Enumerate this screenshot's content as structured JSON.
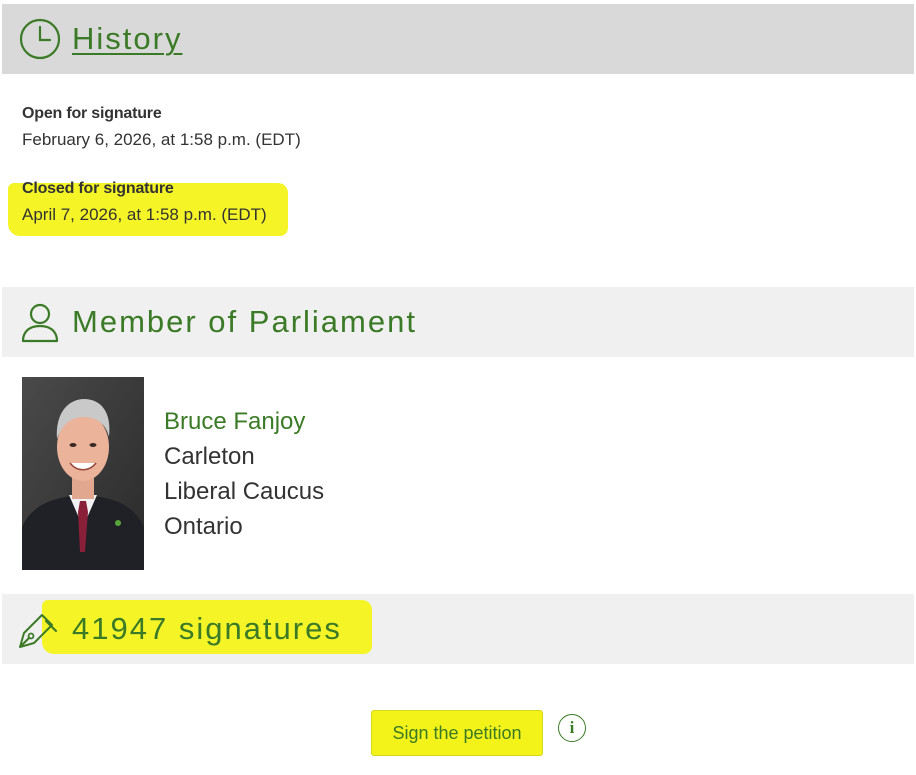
{
  "history": {
    "title": "History",
    "icon": "clock-icon",
    "open_label": "Open for signature",
    "open_value": "February 6, 2026, at 1:58 p.m. (EDT)",
    "closed_label": "Closed for signature",
    "closed_value": "April 7, 2026, at 1:58 p.m. (EDT)"
  },
  "member": {
    "title": "Member of Parliament",
    "icon": "person-icon",
    "name": "Bruce Fanjoy",
    "riding": "Carleton",
    "caucus": "Liberal Caucus",
    "province": "Ontario"
  },
  "signatures": {
    "title": "41947 signatures",
    "icon": "pen-icon"
  },
  "actions": {
    "sign_label": "Sign the petition",
    "info_label": "i",
    "info_icon": "info-icon"
  },
  "colors": {
    "accent": "#3b7a26",
    "highlight": "#f3f31a",
    "header_bg_history": "#d9d9d9",
    "header_bg": "#f0f0f0",
    "text": "#333333"
  }
}
